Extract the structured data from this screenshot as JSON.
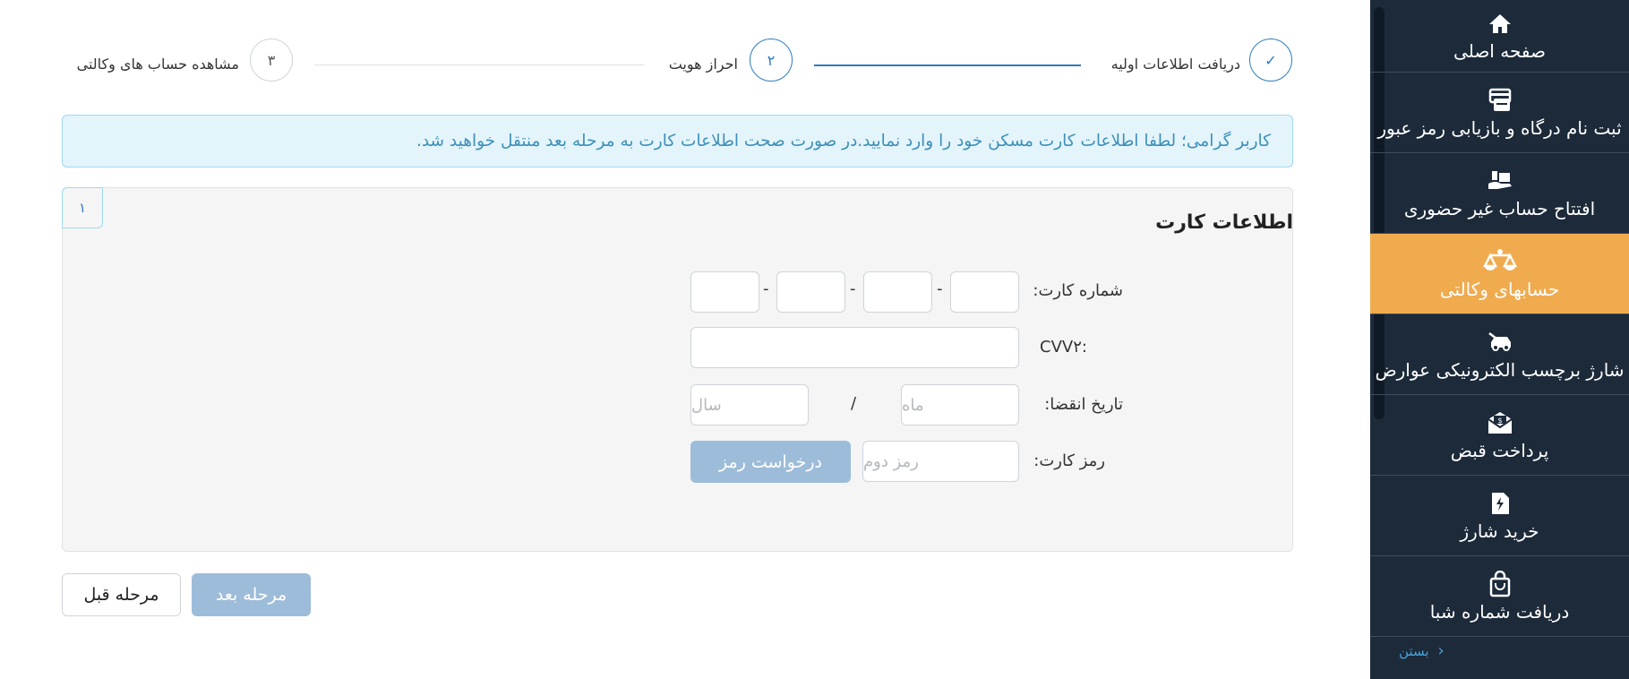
{
  "sidebar": {
    "items": [
      {
        "label": "صفحه اصلی",
        "icon": "home-icon"
      },
      {
        "label": "ثبت نام درگاه و بازیابی رمز عبور",
        "icon": "card-register-icon"
      },
      {
        "label": "افتتاح حساب غیر حضوری",
        "icon": "open-account-icon"
      },
      {
        "label": "حسابهای وکالتی",
        "icon": "scales-icon",
        "active": true
      },
      {
        "label": "شارژ برچسب الکترونیکی عوارض",
        "icon": "car-tag-icon"
      },
      {
        "label": "پرداخت قبض",
        "icon": "bill-envelope-icon"
      },
      {
        "label": "خرید شارژ",
        "icon": "sim-charge-icon"
      },
      {
        "label": "دریافت شماره شبا",
        "icon": "shopping-bag-icon"
      }
    ],
    "close_label": "بستن",
    "bg_color": "#1c2a3a",
    "active_color": "#f0ab4e"
  },
  "stepper": {
    "steps": [
      {
        "number": "✓",
        "label": "دریافت اطلاعات اولیه",
        "state": "done"
      },
      {
        "number": "۲",
        "label": "احراز هویت",
        "state": "current"
      },
      {
        "number": "۳",
        "label": "مشاهده حساب های وکالتی",
        "state": "pending"
      }
    ]
  },
  "alert": {
    "text": "کاربر گرامی؛ لطفا اطلاعات کارت مسکن خود را وارد نمایید.در صورت صحت اطلاعات کارت به مرحله بعد منتقل خواهید شد."
  },
  "card_form": {
    "section_number": "۱",
    "title": "اطلاعات کارت",
    "card_number_label": "شماره کارت:",
    "card_separator": "-",
    "cvv2_label": "CVV۲",
    "expiry_label": "تاریخ انقضا:",
    "month_placeholder": "ماه",
    "year_placeholder": "سال",
    "expiry_separator": "/",
    "pin_label": "رمز کارت:",
    "second_pin_placeholder": "رمز دوم",
    "request_pin_button": "درخواست رمز"
  },
  "actions": {
    "next_button": "مرحله بعد",
    "prev_button": "مرحله قبل"
  }
}
